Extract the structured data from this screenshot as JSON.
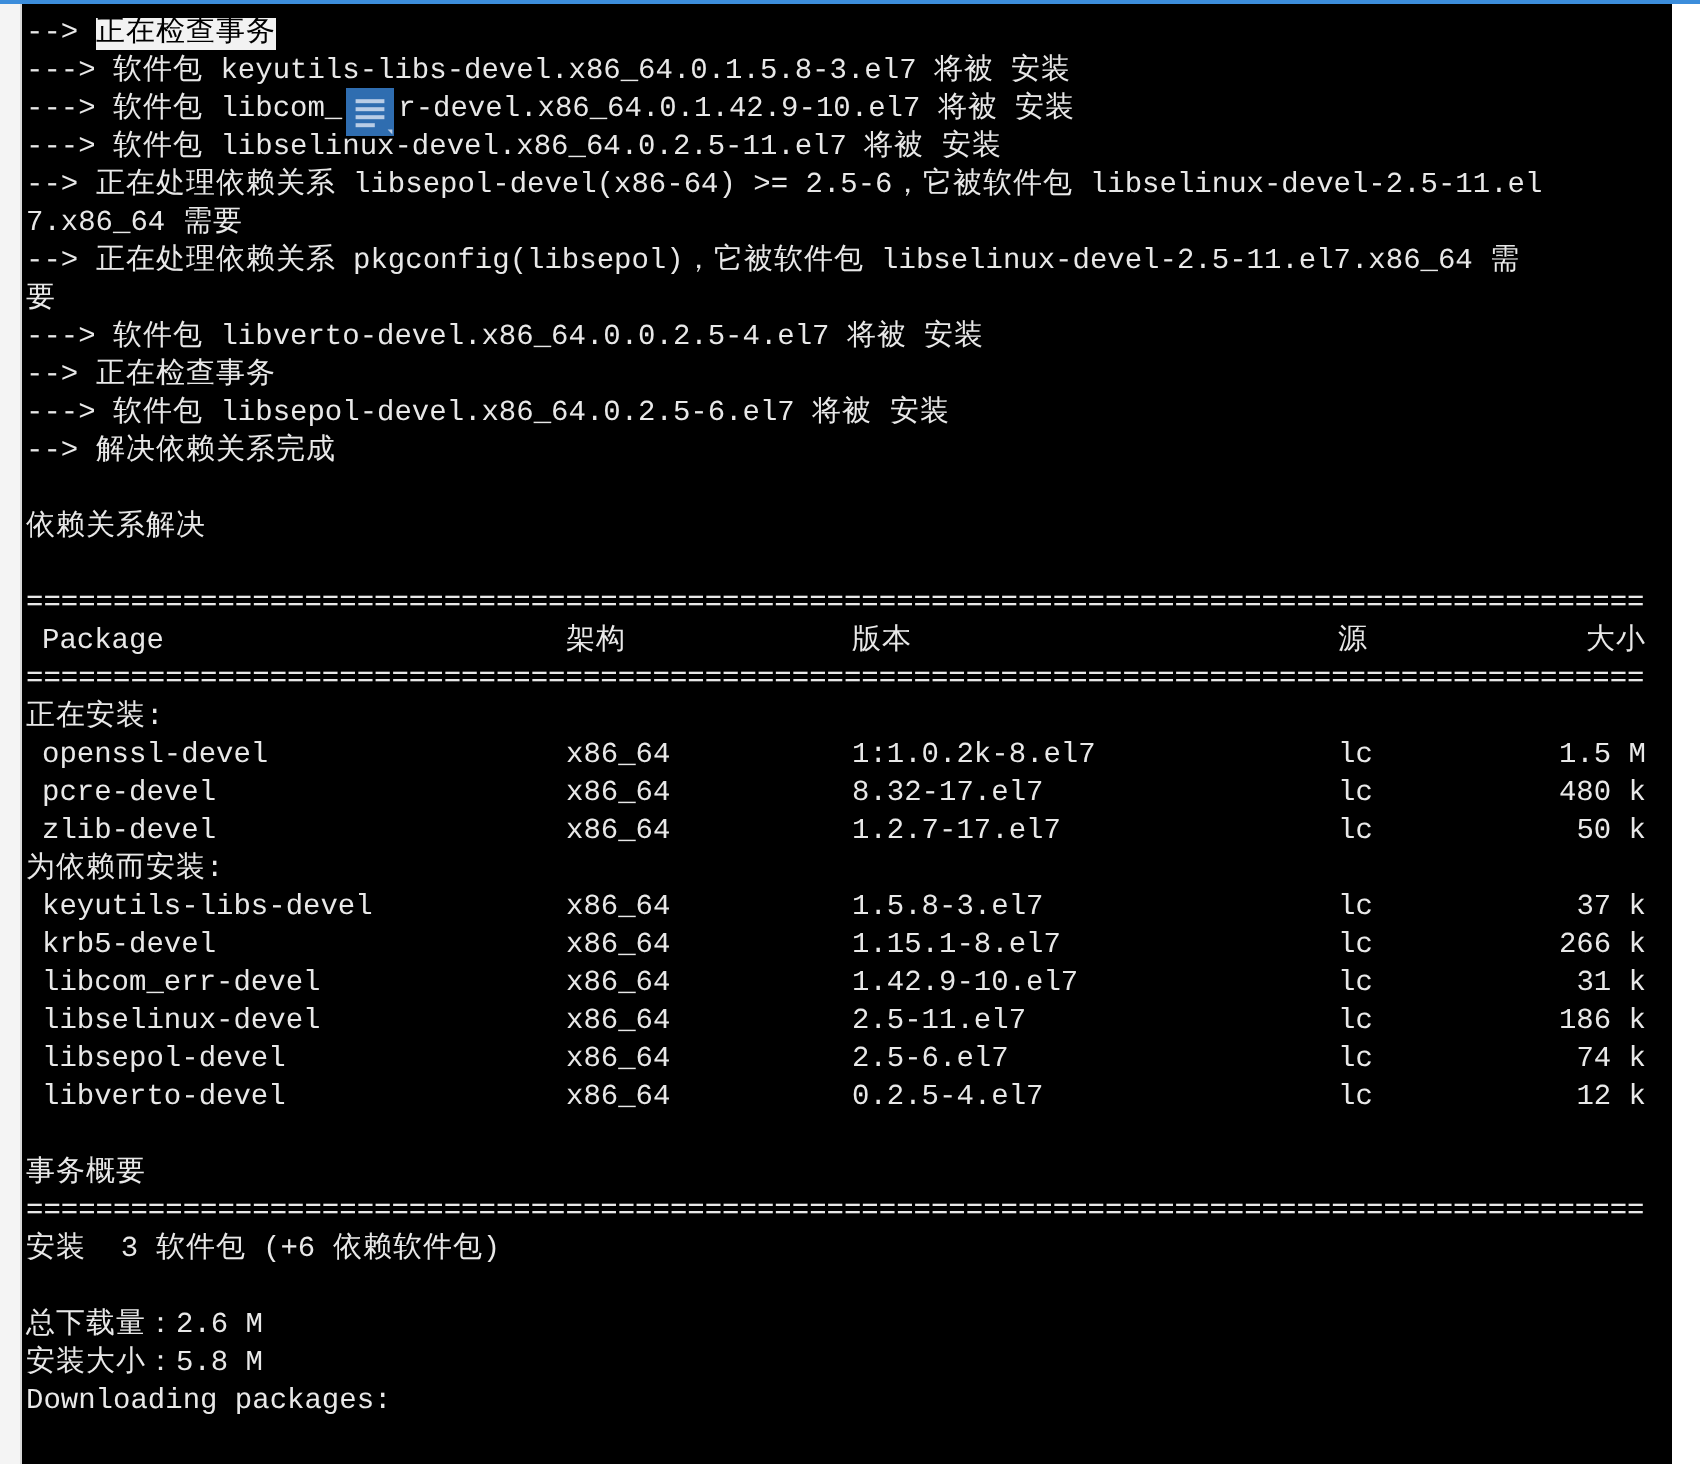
{
  "terminal": {
    "lines": [
      {
        "kind": "text",
        "text": "-->",
        "highlight": "正在检查事务"
      },
      {
        "kind": "text",
        "text": "---> 软件包 keyutils-libs-devel.x86_64.0.1.5.8-3.el7 将被 安装"
      },
      {
        "kind": "covered",
        "text": "---> 软件包 libcom_",
        "rest": "r-devel.x86_64.0.1.42.9-10.el7 将被 安装"
      },
      {
        "kind": "text",
        "text": "---> 软件包 libselinux-devel.x86_64.0.2.5-11.el7 将被 安装"
      },
      {
        "kind": "text",
        "text": "--> 正在处理依赖关系 libsepol-devel(x86-64) >= 2.5-6，它被软件包 libselinux-devel-2.5-11.el"
      },
      {
        "kind": "text",
        "text": "7.x86_64 需要"
      },
      {
        "kind": "text",
        "text": "--> 正在处理依赖关系 pkgconfig(libsepol)，它被软件包 libselinux-devel-2.5-11.el7.x86_64 需"
      },
      {
        "kind": "text",
        "text": "要"
      },
      {
        "kind": "text",
        "text": "---> 软件包 libverto-devel.x86_64.0.0.2.5-4.el7 将被 安装"
      },
      {
        "kind": "text",
        "text": "--> 正在检查事务"
      },
      {
        "kind": "text",
        "text": "---> 软件包 libsepol-devel.x86_64.0.2.5-6.el7 将被 安装"
      },
      {
        "kind": "text",
        "text": "--> 解决依赖关系完成"
      },
      {
        "kind": "blank"
      },
      {
        "kind": "text",
        "text": "依赖关系解决"
      },
      {
        "kind": "blank"
      },
      {
        "kind": "separator",
        "text": "============================================================================================="
      },
      {
        "kind": "header",
        "cells": [
          "Package",
          "架构",
          "版本",
          "源",
          "大小"
        ]
      },
      {
        "kind": "separator",
        "text": "============================================================================================="
      },
      {
        "kind": "group",
        "text": "正在安装:"
      },
      {
        "kind": "row",
        "cells": [
          "openssl-devel",
          "x86_64",
          "1:1.0.2k-8.el7",
          "lc",
          "1.5 M"
        ]
      },
      {
        "kind": "row",
        "cells": [
          "pcre-devel",
          "x86_64",
          "8.32-17.el7",
          "lc",
          "480 k"
        ]
      },
      {
        "kind": "row",
        "cells": [
          "zlib-devel",
          "x86_64",
          "1.2.7-17.el7",
          "lc",
          "50 k"
        ]
      },
      {
        "kind": "group",
        "text": "为依赖而安装:"
      },
      {
        "kind": "row",
        "cells": [
          "keyutils-libs-devel",
          "x86_64",
          "1.5.8-3.el7",
          "lc",
          "37 k"
        ]
      },
      {
        "kind": "row",
        "cells": [
          "krb5-devel",
          "x86_64",
          "1.15.1-8.el7",
          "lc",
          "266 k"
        ]
      },
      {
        "kind": "row",
        "cells": [
          "libcom_err-devel",
          "x86_64",
          "1.42.9-10.el7",
          "lc",
          "31 k"
        ]
      },
      {
        "kind": "row",
        "cells": [
          "libselinux-devel",
          "x86_64",
          "2.5-11.el7",
          "lc",
          "186 k"
        ]
      },
      {
        "kind": "row",
        "cells": [
          "libsepol-devel",
          "x86_64",
          "2.5-6.el7",
          "lc",
          "74 k"
        ]
      },
      {
        "kind": "row",
        "cells": [
          "libverto-devel",
          "x86_64",
          "0.2.5-4.el7",
          "lc",
          "12 k"
        ]
      },
      {
        "kind": "blank"
      },
      {
        "kind": "text",
        "text": "事务概要"
      },
      {
        "kind": "separator",
        "text": "============================================================================================="
      },
      {
        "kind": "text",
        "text": "安装  3 软件包 (+6 依赖软件包)"
      },
      {
        "kind": "blank"
      },
      {
        "kind": "text",
        "text": "总下载量：2.6 M"
      },
      {
        "kind": "text",
        "text": "安装大小：5.8 M"
      },
      {
        "kind": "text",
        "text": "Downloading packages:"
      }
    ]
  }
}
